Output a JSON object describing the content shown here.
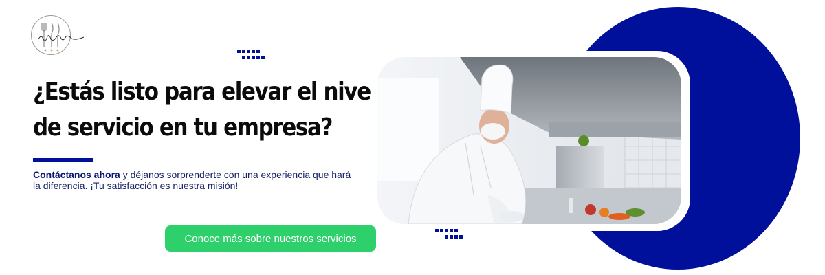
{
  "brand": {
    "logo_icon": "monogram-logo-icon"
  },
  "hero": {
    "headline_line1": "¿Estás listo para elevar el nivel",
    "headline_line2": "de servicio en tu empresa?",
    "paragraph_bold": "Contáctanos ahora",
    "paragraph_rest": " y déjanos sorprenderte con una experiencia que hará la diferencia. ¡Tu satisfacción es nuestra misión!",
    "cta_label": "Conoce más sobre nuestros servicios"
  },
  "image": {
    "icon": "chef-kitchen-photo"
  },
  "colors": {
    "primary_blue": "#00109a",
    "cta_green": "#2ed06b",
    "text_dark": "#0b0b0b"
  }
}
